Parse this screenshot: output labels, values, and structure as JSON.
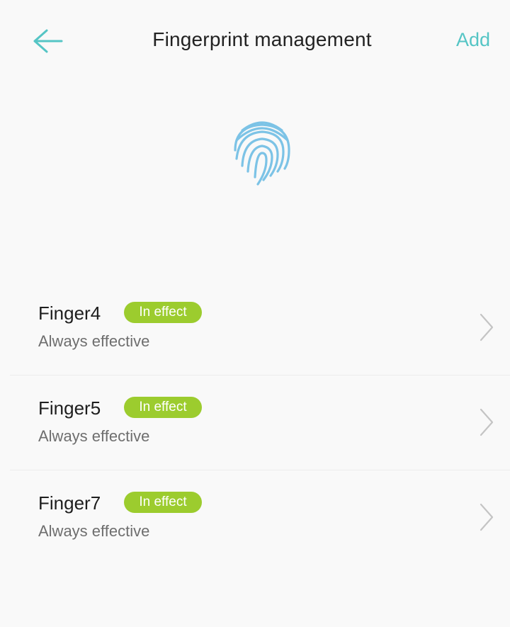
{
  "header": {
    "title": "Fingerprint management",
    "add_label": "Add"
  },
  "icons": {
    "back": "arrow-left-icon",
    "hero": "fingerprint-icon",
    "row_chevron": "chevron-right-icon"
  },
  "colors": {
    "accent": "#55c5c5",
    "fingerprint": "#7cc3e6",
    "badge": "#9ccc2e",
    "background": "#f9f9f9"
  },
  "fingerprints": [
    {
      "name": "Finger4",
      "status": "In effect",
      "schedule": "Always effective"
    },
    {
      "name": "Finger5",
      "status": "In effect",
      "schedule": "Always effective"
    },
    {
      "name": "Finger7",
      "status": "In effect",
      "schedule": "Always effective"
    }
  ]
}
